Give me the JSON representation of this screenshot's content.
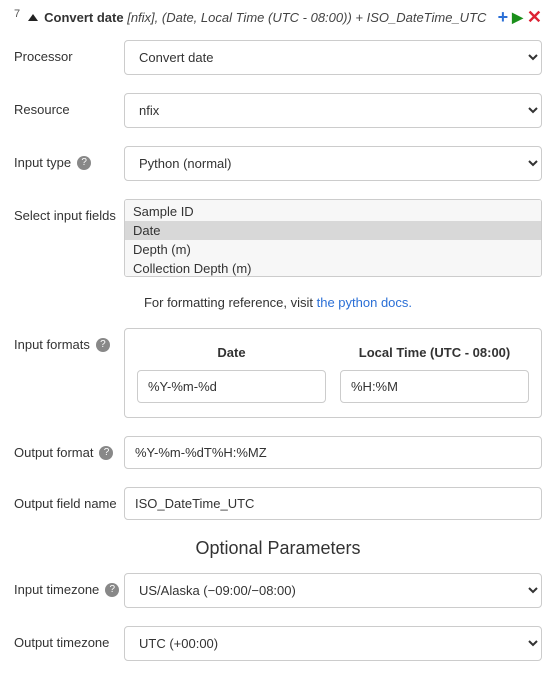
{
  "header": {
    "step_number": "7",
    "title_bold": "Convert date",
    "title_detail": "[nfix], (Date, Local Time (UTC - 08:00)) + ISO_DateTime_UTC"
  },
  "labels": {
    "processor": "Processor",
    "resource": "Resource",
    "input_type": "Input type",
    "select_input_fields": "Select input fields",
    "input_formats": "Input formats",
    "output_format": "Output format",
    "output_field_name": "Output field name",
    "optional_parameters": "Optional Parameters",
    "input_timezone": "Input timezone",
    "output_timezone": "Output timezone"
  },
  "values": {
    "processor": "Convert date",
    "resource": "nfix",
    "input_type": "Python (normal)",
    "output_format": "%Y-%m-%dT%H:%MZ",
    "output_field_name": "ISO_DateTime_UTC",
    "input_timezone": "US/Alaska (−09:00/−08:00)",
    "output_timezone": "UTC (+00:00)"
  },
  "input_fields_options": [
    {
      "label": "Sample ID",
      "selected": false
    },
    {
      "label": "Date",
      "selected": true
    },
    {
      "label": "Depth (m)",
      "selected": false
    },
    {
      "label": "Collection Depth (m)",
      "selected": false
    }
  ],
  "hint": {
    "prefix": "For formatting reference, visit ",
    "link_text": "the python docs."
  },
  "input_formats": [
    {
      "header": "Date",
      "value": "%Y-%m-%d"
    },
    {
      "header": "Local Time (UTC - 08:00)",
      "value": "%H:%M"
    }
  ]
}
